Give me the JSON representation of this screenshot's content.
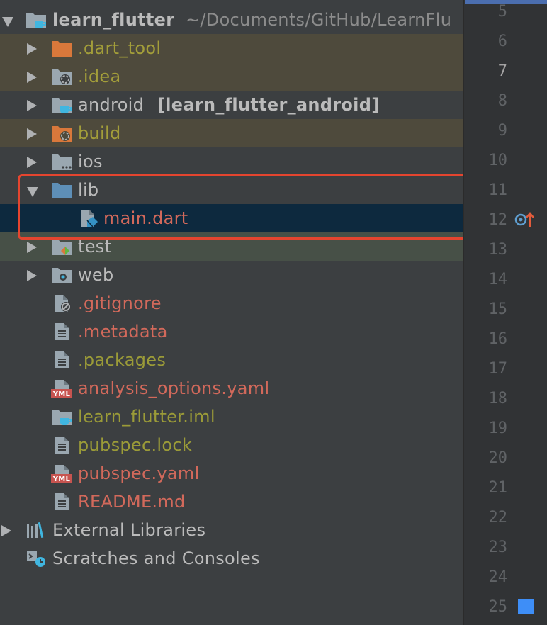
{
  "project": {
    "name": "learn_flutter",
    "path": "~/Documents/GitHub/LearnFlu"
  },
  "items": [
    {
      "label": ".dart_tool"
    },
    {
      "label": ".idea"
    },
    {
      "label": "android",
      "module": "[learn_flutter_android]"
    },
    {
      "label": "build"
    },
    {
      "label": "ios"
    },
    {
      "label": "lib"
    },
    {
      "label": "main.dart"
    },
    {
      "label": "test"
    },
    {
      "label": "web"
    },
    {
      "label": ".gitignore"
    },
    {
      "label": ".metadata"
    },
    {
      "label": ".packages"
    },
    {
      "label": "analysis_options.yaml"
    },
    {
      "label": "learn_flutter.iml"
    },
    {
      "label": "pubspec.lock"
    },
    {
      "label": "pubspec.yaml"
    },
    {
      "label": "README.md"
    }
  ],
  "external_libraries": "External Libraries",
  "scratches": "Scratches and Consoles",
  "line_numbers": [
    "5",
    "6",
    "7",
    "8",
    "9",
    "10",
    "11",
    "12",
    "13",
    "14",
    "15",
    "16",
    "17",
    "18",
    "19",
    "20",
    "21",
    "22",
    "23",
    "24",
    "25"
  ],
  "icon_badges": {
    "yml": "YML"
  },
  "colors": {
    "background": "#3c3f41",
    "selection": "#0d293e",
    "excluded": "#4e4a3c",
    "highlight_box": "#e5452f",
    "gutter": "#313335"
  }
}
